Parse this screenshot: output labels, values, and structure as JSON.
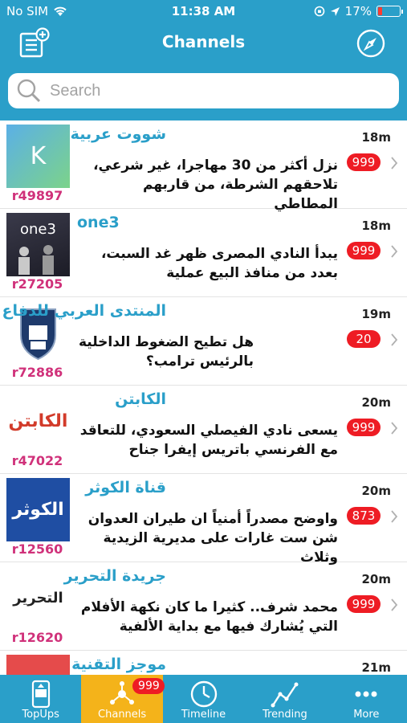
{
  "status": {
    "carrier": "No SIM",
    "time": "11:38 AM",
    "battery": "17%",
    "battery_level": 0.17
  },
  "header": {
    "title": "Channels"
  },
  "search": {
    "placeholder": "Search"
  },
  "channels": [
    {
      "name": "شووت عربية",
      "time": "18m",
      "message": "نزل أكثر من 30 مهاجرا، غير شرعي، تلاحقهم الشرطة، من قاربهم المطاطي",
      "badge": "999",
      "id": "r49897",
      "avatar_letter": "K"
    },
    {
      "name": "one3",
      "time": "18m",
      "message": "يبدأ النادي المصرى ظهر غد السبت، بعدد من منافذ البيع عملية",
      "badge": "999",
      "id": "r27205",
      "avatar_letter": "one3"
    },
    {
      "name": "المنتدى العربي للدفاع",
      "time": "19m",
      "message": "هل تطيح الضغوط الداخلية بالرئيس ترامب؟",
      "badge": "20",
      "id": "r72886"
    },
    {
      "name": "الكابتن",
      "time": "20m",
      "message": "يسعى نادي الفيصلي السعودي، للتعاقد مع الفرنسي باتريس إيفرا جناح",
      "badge": "999",
      "id": "r47022",
      "avatar_letter": "الكابتن"
    },
    {
      "name": "قناة الكوثر",
      "time": "20m",
      "message": "واوضح مصدراً أمنياً ان طيران العدوان شن ست غارات على مديرية الزيدية وثلاث",
      "badge": "873",
      "id": "r12560",
      "avatar_letter": "الكوثر"
    },
    {
      "name": "جريدة التحرير",
      "time": "20m",
      "message": "محمد شرف.. كثيرا ما كان نكهة الأفلام التي يُشارك فيها مع بداية الألفية",
      "badge": "999",
      "id": "r12620",
      "avatar_letter": "التحرير"
    },
    {
      "name": "موجز التقنية",
      "time": "21m"
    }
  ],
  "tabs": [
    {
      "label": "TopUps"
    },
    {
      "label": "Channels",
      "badge": "999"
    },
    {
      "label": "Timeline"
    },
    {
      "label": "Trending"
    },
    {
      "label": "More"
    }
  ],
  "colors": {
    "primary": "#2a9fc9",
    "active_tab": "#f4b31a",
    "badge": "#ee1c24",
    "id_text": "#d0317a"
  }
}
